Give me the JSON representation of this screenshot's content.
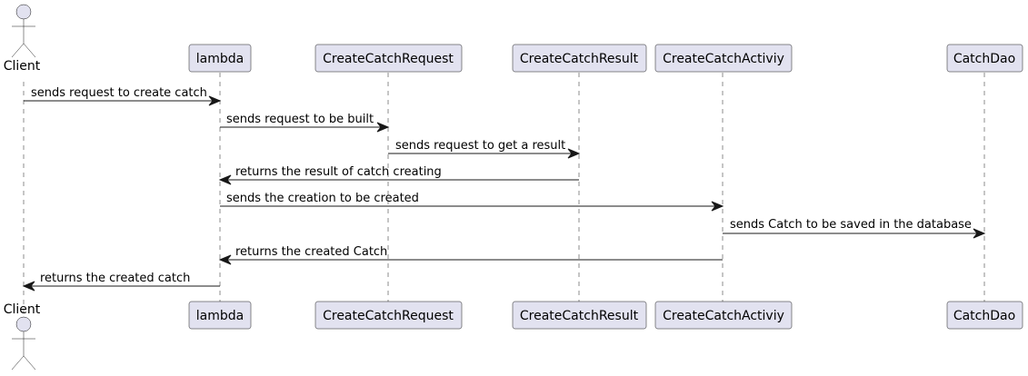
{
  "participants": [
    {
      "id": "client",
      "label": "Client",
      "kind": "actor"
    },
    {
      "id": "lambda",
      "label": "lambda",
      "kind": "participant"
    },
    {
      "id": "request",
      "label": "CreateCatchRequest",
      "kind": "participant"
    },
    {
      "id": "result",
      "label": "CreateCatchResult",
      "kind": "participant"
    },
    {
      "id": "activity",
      "label": "CreateCatchActiviy",
      "kind": "participant"
    },
    {
      "id": "dao",
      "label": "CatchDao",
      "kind": "participant"
    }
  ],
  "messages": [
    {
      "from": "client",
      "to": "lambda",
      "label": "sends request to create catch"
    },
    {
      "from": "lambda",
      "to": "request",
      "label": "sends request to be built"
    },
    {
      "from": "request",
      "to": "result",
      "label": "sends request to get a result"
    },
    {
      "from": "result",
      "to": "lambda",
      "label": "returns the result of catch creating"
    },
    {
      "from": "lambda",
      "to": "activity",
      "label": "sends the creation to be created"
    },
    {
      "from": "activity",
      "to": "dao",
      "label": "sends Catch to be saved in the database"
    },
    {
      "from": "activity",
      "to": "lambda",
      "label": "returns the created Catch"
    },
    {
      "from": "lambda",
      "to": "client",
      "label": "returns the created catch"
    }
  ],
  "colors": {
    "participant_fill": "#E2E2F0",
    "stroke": "#181818"
  }
}
